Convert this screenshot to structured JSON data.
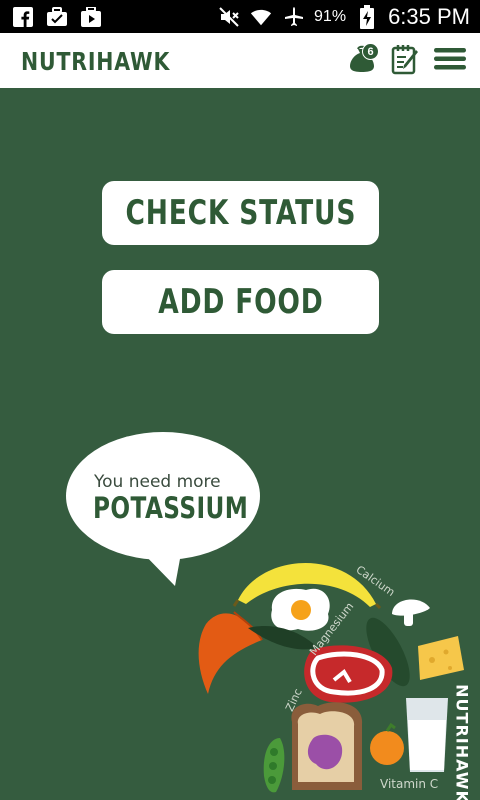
{
  "status_bar": {
    "battery": "91%",
    "time": "6:35 PM",
    "left_icons": [
      "facebook-icon",
      "briefcase-icon",
      "play-store-icon"
    ],
    "right_icons": [
      "mute-icon",
      "wifi-icon",
      "airplane-icon",
      "battery-charging-icon"
    ]
  },
  "header": {
    "title": "NUTRIHAWK",
    "bag_badge": "6",
    "icons": [
      "food-bag-icon",
      "notepad-icon",
      "hamburger-menu-icon"
    ]
  },
  "main": {
    "check_status_label": "CHECK STATUS",
    "add_food_label": "ADD FOOD"
  },
  "bubble": {
    "line1": "You need more",
    "line2": "POTASSIUM"
  },
  "illustration": {
    "labels": {
      "calcium": "Calcium",
      "magnesium": "Magnesium",
      "zinc": "Zinc",
      "vitamin_c": "Vitamin C"
    },
    "brand": "NUTRIHAWK"
  },
  "colors": {
    "background": "#355c3f",
    "brand_green": "#2f5a36",
    "white": "#ffffff"
  }
}
